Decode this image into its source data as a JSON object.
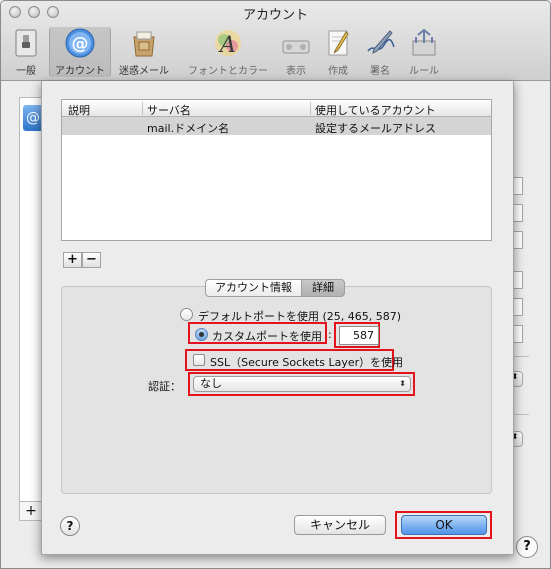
{
  "window": {
    "title": "アカウント"
  },
  "toolbar": {
    "items": [
      {
        "label": "一般",
        "icon": "general-switch-icon"
      },
      {
        "label": "アカウント",
        "icon": "at-sign-icon"
      },
      {
        "label": "迷惑メール",
        "icon": "junk-bag-icon"
      },
      {
        "label": "フォントとカラー",
        "icon": "font-a-icon"
      },
      {
        "label": "表示",
        "icon": "display-icon"
      },
      {
        "label": "作成",
        "icon": "compose-pencil-icon"
      },
      {
        "label": "署名",
        "icon": "signature-pen-icon"
      },
      {
        "label": "ルール",
        "icon": "rules-arrows-icon"
      }
    ]
  },
  "server_table": {
    "headers": [
      "説明",
      "サーバ名",
      "使用しているアカウント"
    ],
    "rows": [
      [
        "",
        "mail.ドメイン名",
        "設定するメールアドレス"
      ]
    ]
  },
  "list_buttons": {
    "add": "+",
    "remove": "−"
  },
  "tabs": {
    "account_info": "アカウント情報",
    "advanced": "詳細",
    "selected": "詳細"
  },
  "advanced": {
    "default_port_label": "デフォルトポートを使用 (25, 465, 587)",
    "custom_port_label": "カスタムポートを使用",
    "port_colon": ":",
    "port_value": "587",
    "ssl_label": "SSL（Secure Sockets Layer）を使用",
    "auth_label": "認証：",
    "auth_value": "なし",
    "use_custom_port": true,
    "use_ssl": false
  },
  "footer": {
    "help": "?",
    "cancel": "キャンセル",
    "ok": "OK"
  },
  "background": {
    "add": "+",
    "help": "?",
    "select_arrow": "⬍"
  },
  "colors": {
    "highlight_red": "#e3131e",
    "default_button_blue": "#4f93e8"
  }
}
